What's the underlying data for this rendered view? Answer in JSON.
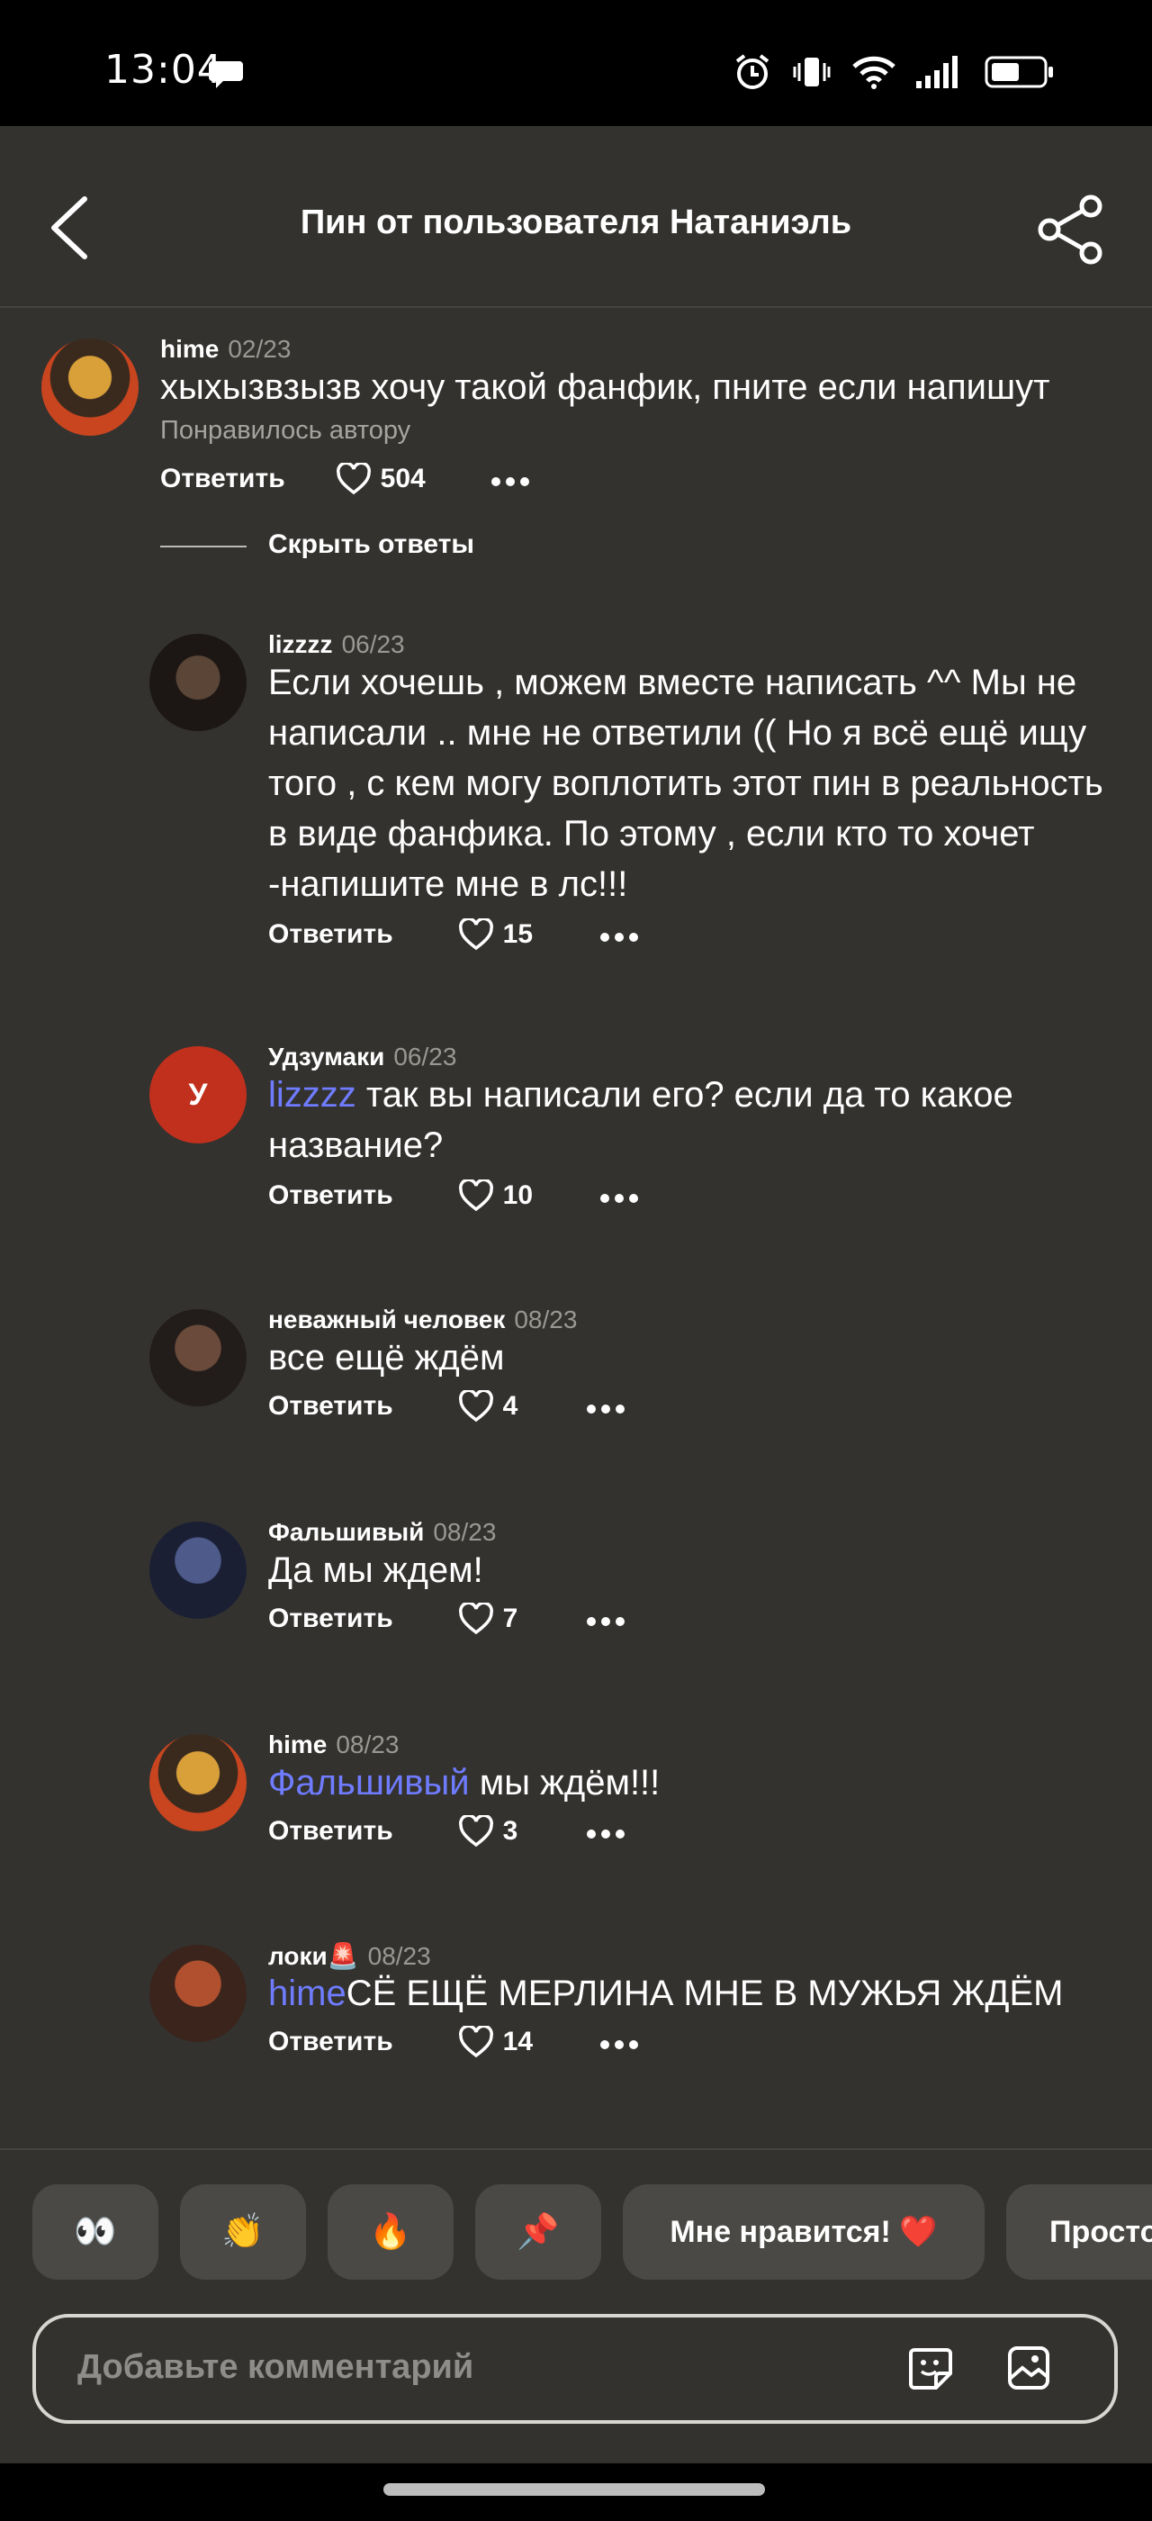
{
  "status_bar": {
    "time": "13:04"
  },
  "header": {
    "title": "Пин от пользователя Натаниэль"
  },
  "comments": [
    {
      "author": "hime",
      "date": "02/23",
      "text": "хыхызвзызв хочу такой фанфик, пните если напишут",
      "liked_by_author": "Понравилось автору",
      "reply_label": "Ответить",
      "likes": "504"
    }
  ],
  "hide_replies_label": "Скрыть ответы",
  "replies": [
    {
      "author": "lizzzz",
      "date": "06/23",
      "text": "Если хочешь , можем вместе написать ^^ Мы не написали .. мне не ответили (( Но я всё ещё ищу того , с кем могу воплотить этот пин в реальность в виде фанфика. По этому , если кто то хочет -напишите мне в лс!!!",
      "reply_label": "Ответить",
      "likes": "15"
    },
    {
      "author": "Удзумаки",
      "date": "06/23",
      "avatar_letter": "У",
      "mention": "lizzzz",
      "text": " так вы написали его? если да то какое название?",
      "reply_label": "Ответить",
      "likes": "10"
    },
    {
      "author": "неважный человек",
      "date": "08/23",
      "text": "все ещё ждём",
      "reply_label": "Ответить",
      "likes": "4"
    },
    {
      "author": "Фальшивый",
      "date": "08/23",
      "text": "Да мы ждем!",
      "reply_label": "Ответить",
      "likes": "7"
    },
    {
      "author": "hime",
      "date": "08/23",
      "mention": "Фальшивый",
      "text": " мы ждём!!!",
      "reply_label": "Ответить",
      "likes": "3"
    },
    {
      "author": "локи🚨",
      "date": "08/23",
      "mention": "hime",
      "text": "СЁ ЕЩЁ МЕРЛИНА МНЕ В МУЖЬЯ ЖДЁМ",
      "reply_label": "Ответить",
      "likes": "14"
    }
  ],
  "reactions": [
    "👀",
    "👏",
    "🔥",
    "📌",
    "Мне нравится! ❤️",
    "Просто"
  ],
  "composer": {
    "placeholder": "Добавьте комментарий"
  },
  "colors": {
    "background": "#33322f",
    "mention": "#6f7cff",
    "avatar_red": "#c0301d"
  },
  "icons": [
    "chat-bubble-icon",
    "alarm-icon",
    "vibrate-icon",
    "wifi-icon",
    "signal-icon",
    "battery-icon",
    "back-arrow-icon",
    "share-icon",
    "heart-icon",
    "more-icon",
    "sticker-icon",
    "image-icon"
  ]
}
